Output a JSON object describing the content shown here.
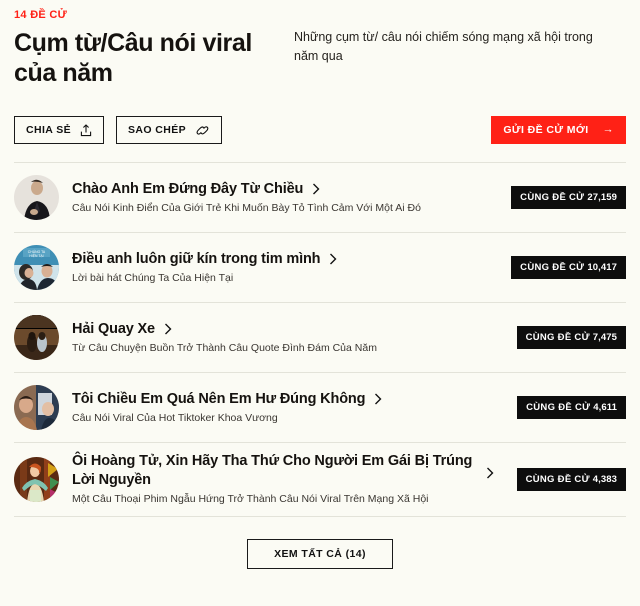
{
  "header": {
    "eyebrow": "14 ĐỀ CỬ",
    "title": "Cụm từ/Câu nói viral của năm",
    "description": "Những cụm từ/ câu nói chiếm sóng mạng xã hội trong năm qua"
  },
  "actions": {
    "share_label": "CHIA SẺ",
    "share_icon": "share-upload-icon",
    "copy_label": "SAO CHÉP",
    "copy_icon": "link-chain-icon",
    "submit_label": "GỬI ĐỀ CỬ MỚI",
    "submit_icon": "arrow-right-icon",
    "accent_color": "#ff2116"
  },
  "list": {
    "vote_prefix": "CÙNG ĐỀ CỬ",
    "items": [
      {
        "title": "Chào Anh Em Đứng Đây Từ Chiều",
        "subtitle": "Câu Nói Kinh Điển Của Giới Trẻ Khi Muốn Bày Tỏ Tình Cảm Với Một Ai Đó",
        "votes": "27,159",
        "avatar": "man-in-black-suit-portrait"
      },
      {
        "title": "Điều anh luôn giữ kín trong tim mình",
        "subtitle": "Lời bài hát Chúng Ta Của Hiện Tại",
        "votes": "10,417",
        "avatar": "music-video-couple-blue"
      },
      {
        "title": "Hải Quay Xe",
        "subtitle": "Từ Câu Chuyện Buồn Trở Thành Câu Quote Đình Đám Của Năm",
        "votes": "7,475",
        "avatar": "couple-dark-brown-scene"
      },
      {
        "title": "Tôi Chiều Em Quá Nên Em Hư Đúng Không",
        "subtitle": "Câu Nói Viral Của Hot Tiktoker Khoa Vương",
        "votes": "4,611",
        "avatar": "two-people-selfie"
      },
      {
        "title": "Ôi Hoàng Tử, Xin Hãy Tha Thứ Cho Người Em Gái Bị Trúng Lời Nguyền",
        "subtitle": "Một Câu Thoại Phim Ngẫu Hứng Trở Thành Câu Nói Viral Trên Mạng Xã Hội",
        "votes": "4,383",
        "avatar": "stage-performer-orange"
      }
    ]
  },
  "footer": {
    "view_all_label": "XEM TẤT CẢ (14)"
  }
}
